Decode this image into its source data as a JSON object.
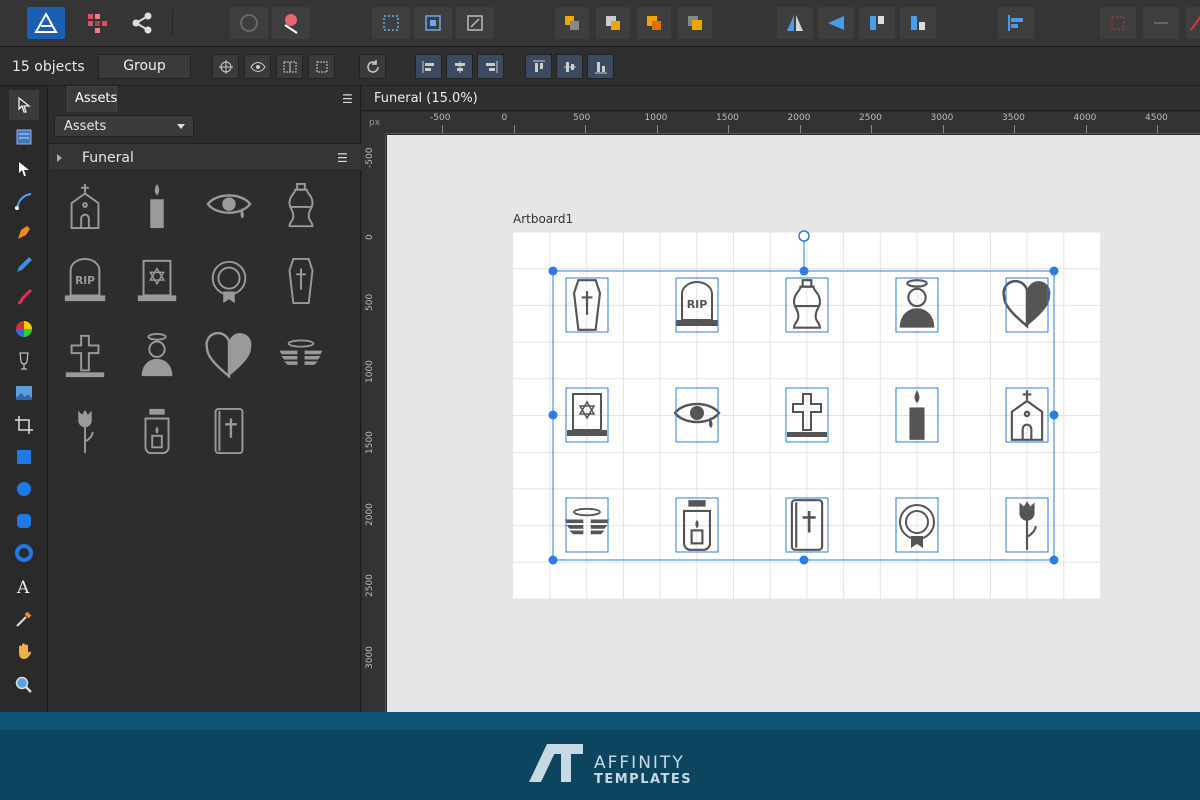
{
  "context": {
    "object_count": "15 objects",
    "group_label": "Group"
  },
  "panel": {
    "tab_label": "Assets",
    "dropdown_value": "Assets",
    "category": "Funeral"
  },
  "document": {
    "tab_title": "Funeral (15.0%)",
    "artboard_label": "Artboard1"
  },
  "ruler": {
    "unit": "px",
    "h_labels": [
      "-500",
      "0",
      "500",
      "1000",
      "1500",
      "2000",
      "2500",
      "3000",
      "3500",
      "4000",
      "4500"
    ],
    "v_labels": [
      "-500",
      "0",
      "500",
      "1000",
      "1500",
      "2000",
      "2500",
      "3000"
    ]
  },
  "assets": [
    {
      "name": "church-icon"
    },
    {
      "name": "candle-icon"
    },
    {
      "name": "crying-eye-icon"
    },
    {
      "name": "urn-icon"
    },
    {
      "name": "rip-tombstone-icon"
    },
    {
      "name": "star-of-david-tombstone-icon"
    },
    {
      "name": "wreath-icon"
    },
    {
      "name": "coffin-icon"
    },
    {
      "name": "cross-icon"
    },
    {
      "name": "angel-person-icon"
    },
    {
      "name": "broken-heart-icon"
    },
    {
      "name": "angel-wings-icon"
    },
    {
      "name": "tulip-icon"
    },
    {
      "name": "lantern-icon"
    },
    {
      "name": "bible-icon"
    }
  ],
  "canvas_icons": [
    "coffin-icon",
    "rip-tombstone-icon",
    "urn-icon",
    "angel-person-icon",
    "broken-heart-icon",
    "star-of-david-tombstone-icon",
    "crying-eye-icon",
    "cross-icon",
    "candle-icon",
    "church-icon",
    "angel-wings-icon",
    "lantern-icon",
    "bible-icon",
    "wreath-icon",
    "tulip-icon"
  ],
  "footer": {
    "brand_line1": "AFFINITY",
    "brand_line2": "TEMPLATES"
  },
  "colors": {
    "accent": "#2a7de1",
    "selection": "#1f6fd6",
    "footer_bg": "#0d4560",
    "icon_dark": "#555555",
    "icon_outline": "#9a9a9a"
  }
}
